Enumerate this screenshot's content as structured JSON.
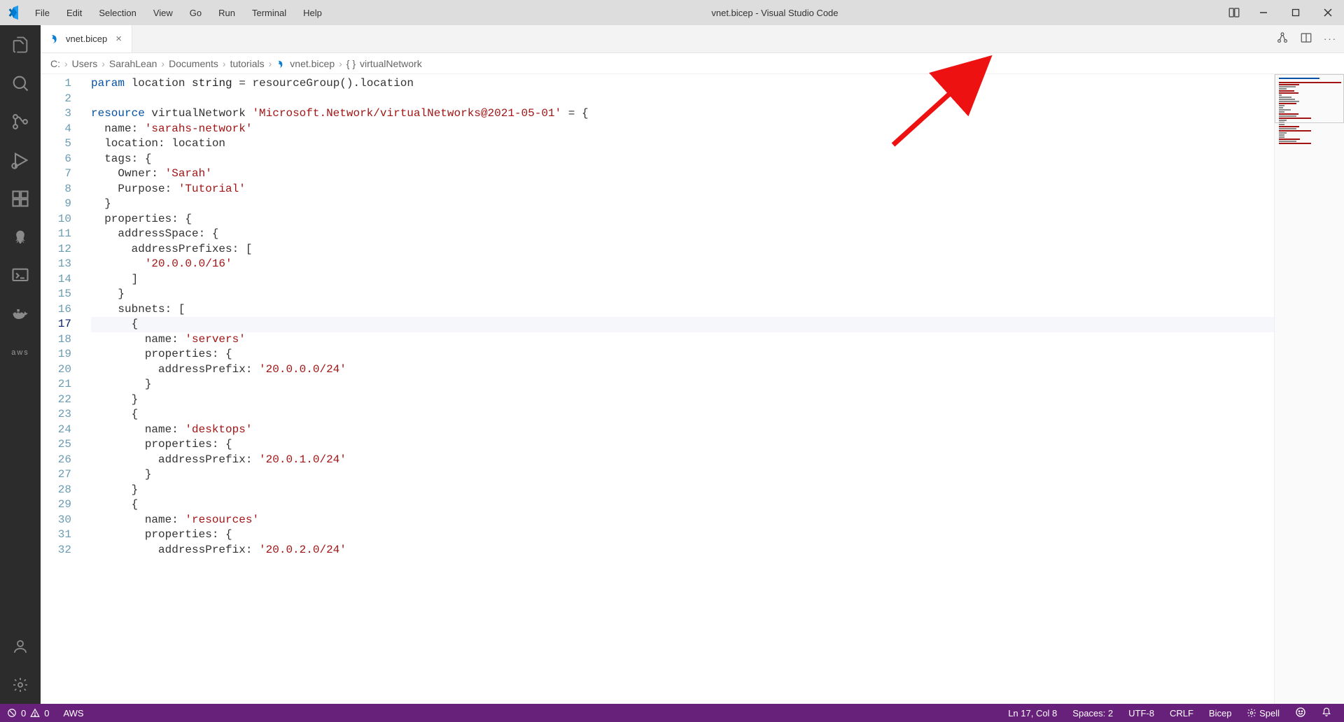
{
  "title": "vnet.bicep - Visual Studio Code",
  "menus": [
    "File",
    "Edit",
    "Selection",
    "View",
    "Go",
    "Run",
    "Terminal",
    "Help"
  ],
  "tab": {
    "name": "vnet.bicep"
  },
  "breadcrumbs": {
    "parts": [
      "C:",
      "Users",
      "SarahLean",
      "Documents",
      "tutorials"
    ],
    "file": "vnet.bicep",
    "symbol": "virtualNetwork"
  },
  "code": {
    "lines": [
      [
        [
          "kw",
          "param"
        ],
        [
          "sp",
          " "
        ],
        [
          "id",
          "location"
        ],
        [
          "sp",
          " "
        ],
        [
          "type",
          "string"
        ],
        [
          "sp",
          " "
        ],
        [
          "op",
          "="
        ],
        [
          "sp",
          " "
        ],
        [
          "id",
          "resourceGroup().location"
        ]
      ],
      [
        [
          "sp",
          ""
        ]
      ],
      [
        [
          "kw",
          "resource"
        ],
        [
          "sp",
          " "
        ],
        [
          "id",
          "virtualNetwork"
        ],
        [
          "sp",
          " "
        ],
        [
          "str",
          "'Microsoft.Network/virtualNetworks@2021-05-01'"
        ],
        [
          "sp",
          " "
        ],
        [
          "op",
          "= {"
        ]
      ],
      [
        [
          "sp",
          "  name: "
        ],
        [
          "str",
          "'sarahs-network'"
        ]
      ],
      [
        [
          "sp",
          "  location: location"
        ]
      ],
      [
        [
          "sp",
          "  tags: {"
        ]
      ],
      [
        [
          "sp",
          "    Owner: "
        ],
        [
          "str",
          "'Sarah'"
        ]
      ],
      [
        [
          "sp",
          "    Purpose: "
        ],
        [
          "str",
          "'Tutorial'"
        ]
      ],
      [
        [
          "sp",
          "  }"
        ]
      ],
      [
        [
          "sp",
          "  properties: {"
        ]
      ],
      [
        [
          "sp",
          "    addressSpace: {"
        ]
      ],
      [
        [
          "sp",
          "      addressPrefixes: ["
        ]
      ],
      [
        [
          "sp",
          "        "
        ],
        [
          "str",
          "'20.0.0.0/16'"
        ]
      ],
      [
        [
          "sp",
          "      ]"
        ]
      ],
      [
        [
          "sp",
          "    }"
        ]
      ],
      [
        [
          "sp",
          "    subnets: ["
        ]
      ],
      [
        [
          "sp",
          "      {"
        ]
      ],
      [
        [
          "sp",
          "        name: "
        ],
        [
          "str",
          "'servers'"
        ]
      ],
      [
        [
          "sp",
          "        properties: {"
        ]
      ],
      [
        [
          "sp",
          "          addressPrefix: "
        ],
        [
          "str",
          "'20.0.0.0/24'"
        ]
      ],
      [
        [
          "sp",
          "        }"
        ]
      ],
      [
        [
          "sp",
          "      }"
        ]
      ],
      [
        [
          "sp",
          "      {"
        ]
      ],
      [
        [
          "sp",
          "        name: "
        ],
        [
          "str",
          "'desktops'"
        ]
      ],
      [
        [
          "sp",
          "        properties: {"
        ]
      ],
      [
        [
          "sp",
          "          addressPrefix: "
        ],
        [
          "str",
          "'20.0.1.0/24'"
        ]
      ],
      [
        [
          "sp",
          "        }"
        ]
      ],
      [
        [
          "sp",
          "      }"
        ]
      ],
      [
        [
          "sp",
          "      {"
        ]
      ],
      [
        [
          "sp",
          "        name: "
        ],
        [
          "str",
          "'resources'"
        ]
      ],
      [
        [
          "sp",
          "        properties: {"
        ]
      ],
      [
        [
          "sp",
          "          addressPrefix: "
        ],
        [
          "str",
          "'20.0.2.0/24'"
        ]
      ]
    ],
    "current_line": 17
  },
  "status": {
    "errors": "0",
    "warnings": "0",
    "aws": "AWS",
    "ln_col": "Ln 17, Col 8",
    "spaces": "Spaces: 2",
    "encoding": "UTF-8",
    "eol": "CRLF",
    "lang": "Bicep",
    "spell": "Spell"
  }
}
